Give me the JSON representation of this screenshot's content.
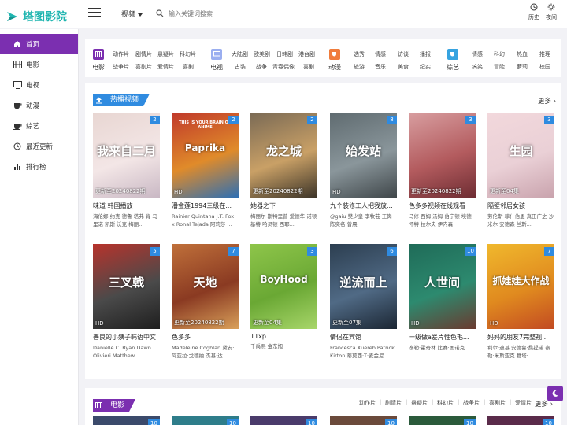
{
  "brand": {
    "name": "塔图影院",
    "color": "#1fb5b0",
    "accent": "#7b2fb0"
  },
  "search": {
    "type_label": "视频",
    "placeholder": "输入关键词搜索"
  },
  "top_actions": [
    {
      "label": "历史",
      "icon": "history-icon"
    },
    {
      "label": "夜间",
      "icon": "moon-icon"
    }
  ],
  "sidebar": {
    "items": [
      {
        "label": "首页",
        "icon": "home-icon",
        "active": true
      },
      {
        "label": "电影",
        "icon": "film-icon"
      },
      {
        "label": "电视",
        "icon": "tv-icon"
      },
      {
        "label": "动漫",
        "icon": "cup-icon"
      },
      {
        "label": "综艺",
        "icon": "cup-icon"
      },
      {
        "label": "最近更新",
        "icon": "history-icon"
      },
      {
        "label": "排行榜",
        "icon": "bar-chart-icon"
      }
    ]
  },
  "categories": [
    {
      "name": "电影",
      "color": "#7b2fb0",
      "links": [
        [
          "动作片",
          "剧情片",
          "悬疑片",
          "科幻片"
        ],
        [
          "战争片",
          "喜剧片",
          "爱情片",
          "喜剧"
        ]
      ]
    },
    {
      "name": "电视",
      "color": "#9aaef0",
      "links": [
        [
          "大陆剧",
          "欧美剧",
          "日韩剧",
          "港台剧"
        ],
        [
          "古装",
          "战争",
          "青春偶像",
          "喜剧"
        ]
      ]
    },
    {
      "name": "动漫",
      "color": "#f07c3c",
      "links": [
        [
          "选秀",
          "情感",
          "访谈",
          "播报"
        ],
        [
          "旅游",
          "音乐",
          "美食",
          "纪实"
        ]
      ]
    },
    {
      "name": "综艺",
      "color": "#36a3e0",
      "links": [
        [
          "情感",
          "科幻",
          "热血",
          "推理"
        ],
        [
          "搞笑",
          "冒险",
          "萝莉",
          "校园"
        ]
      ]
    }
  ],
  "hot": {
    "title": "热播视频",
    "more": "更多",
    "items": [
      {
        "title": "味道 韩国播放",
        "cast": "海伦娜·约克 德鲁·塔弗 肯·马里诺 凯斯·沃克 梅丽...",
        "num": "2",
        "status": "更新至20240822期",
        "poster_text": "我来自二月",
        "poster_sub": "",
        "bg": [
          "#e8d6d2",
          "#f3e6e6",
          "#c9b8c4"
        ]
      },
      {
        "title": "潘金莲1994三级在...",
        "cast": "Rainier Quintana J.T. Fox x Ronal Tejada 阿莉莎 ...",
        "num": "2",
        "status": "HD",
        "poster_text": "Paprika",
        "poster_sub": "THIS IS YOUR BRAIN ON ANIME",
        "bg": [
          "#c0392b",
          "#e08b2a",
          "#2e6fb3"
        ]
      },
      {
        "title": "她器之下",
        "cast": "梅丽尔·斯特里普 爱德华·诺顿 基特·哈灵顿 西耶...",
        "num": "2",
        "status": "更新至20240822期",
        "poster_text": "龙之城",
        "poster_sub": "",
        "bg": [
          "#7a6a55",
          "#c9a066",
          "#3c3428"
        ]
      },
      {
        "title": "九个装修工人把我放...",
        "cast": "@gaiu 樊少皇 李牧芸 王岗 陈奕名 曾晨",
        "num": "8",
        "status": "HD",
        "poster_text": "始发站",
        "poster_sub": "",
        "bg": [
          "#5f6b70",
          "#8a969b",
          "#3f4649"
        ]
      },
      {
        "title": "色多多视频在线观看",
        "cast": "马修·西姆 汤姆·伯宁顿 埃德·怀特 拉尔夫·伊内森",
        "num": "3",
        "status": "更新至20240822期",
        "poster_text": "",
        "poster_sub": "",
        "bg": [
          "#d89ea0",
          "#b35b5e",
          "#6e2d33"
        ]
      },
      {
        "title": "隔壁邻居女孩",
        "cast": "劳伦斯·菲什伯恩 真田广之 沙米尔·安德森 兰斯...",
        "num": "3",
        "status": "更新至04集",
        "poster_text": "生园",
        "poster_sub": "",
        "bg": [
          "#f2d8dc",
          "#ead0d6",
          "#c9a3ad"
        ]
      },
      {
        "title": "善良的小姨子韩语中文",
        "cast": "Danielle C. Ryan Dawn Olivieri Matthew Lawrenc...",
        "num": "5",
        "status": "HD",
        "poster_text": "三叉戟",
        "poster_sub": "",
        "bg": [
          "#b7332c",
          "#4a4a4a",
          "#1e1e1e"
        ]
      },
      {
        "title": "色多多",
        "cast": "Madeleine Coghlan 黛安·阿亚拉·戈德纳 杰基·达...",
        "num": "7",
        "status": "更新至20240822期",
        "poster_text": "天地",
        "poster_sub": "",
        "bg": [
          "#c0703a",
          "#8a3a22",
          "#d9a05a"
        ]
      },
      {
        "title": "11xp",
        "cast": "千禹熙 金东旭",
        "num": "3",
        "status": "更新至04集",
        "poster_text": "BoyHood",
        "poster_sub": "",
        "bg": [
          "#8ec54a",
          "#6aa834",
          "#a8d66a"
        ]
      },
      {
        "title": "情侣在宾馆",
        "cast": "Francesca Xuereb Patrick Kirton 蒂莫西·T·麦金尼",
        "num": "6",
        "status": "更新至07集",
        "poster_text": "逆流而上",
        "poster_sub": "",
        "bg": [
          "#2c3e50",
          "#506a85",
          "#1b2633"
        ]
      },
      {
        "title": "一级做a爰片性色毛...",
        "cast": "泰勒·霍奇林 比赛·图诺克",
        "num": "10",
        "status": "HD",
        "poster_text": "人世间",
        "poster_sub": "",
        "bg": [
          "#1f6b58",
          "#2d8a6f",
          "#6a3a2f"
        ]
      },
      {
        "title": "妈妈的朋友7完整视...",
        "cast": "利尔·迪基 安德鲁·桑提诺 泰勒·米斯亚克 葛塔·...",
        "num": "7",
        "status": "HD",
        "poster_text": "抓娃娃大作战",
        "poster_sub": "",
        "bg": [
          "#f0b82d",
          "#e08a1f",
          "#c24a22"
        ]
      }
    ]
  },
  "movie_section": {
    "title": "电影",
    "tags": [
      "动作片",
      "剧情片",
      "悬疑片",
      "科幻片",
      "战争片",
      "喜剧片",
      "爱情片"
    ],
    "more": "更多",
    "nums": [
      "10",
      "10",
      "10",
      "10",
      "10",
      "10"
    ]
  }
}
